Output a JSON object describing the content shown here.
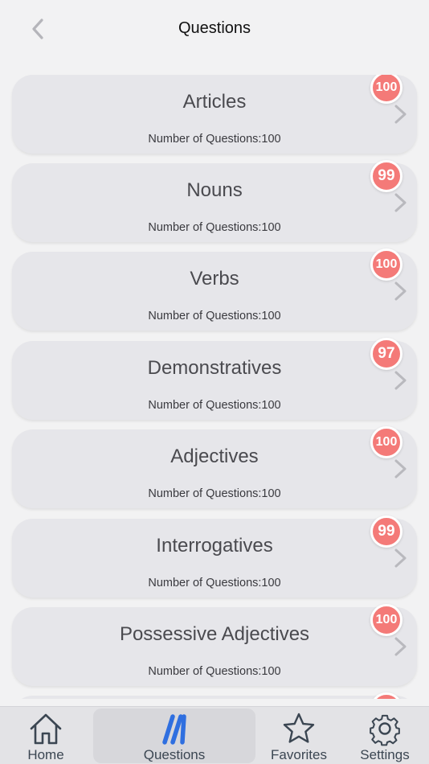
{
  "header": {
    "title": "Questions",
    "back_icon": "chevron-left-icon"
  },
  "categories": [
    {
      "title": "Articles",
      "subtitle": "Number of Questions:100",
      "badge": "100"
    },
    {
      "title": "Nouns",
      "subtitle": "Number of Questions:100",
      "badge": "99"
    },
    {
      "title": "Verbs",
      "subtitle": "Number of Questions:100",
      "badge": "100"
    },
    {
      "title": "Demonstratives",
      "subtitle": "Number of Questions:100",
      "badge": "97"
    },
    {
      "title": "Adjectives",
      "subtitle": "Number of Questions:100",
      "badge": "100"
    },
    {
      "title": "Interrogatives",
      "subtitle": "Number of Questions:100",
      "badge": "99"
    },
    {
      "title": "Possessive Adjectives",
      "subtitle": "Number of Questions:100",
      "badge": "100"
    }
  ],
  "tabbar": {
    "items": [
      {
        "label": "Home",
        "icon": "home-icon"
      },
      {
        "label": "Questions",
        "icon": "questions-icon",
        "active": true
      },
      {
        "label": "Favorites",
        "icon": "star-icon"
      },
      {
        "label": "Settings",
        "icon": "gear-icon"
      }
    ]
  },
  "colors": {
    "background": "#f2f2f3",
    "card": "#e6e6ea",
    "badge": "#f47a78",
    "accent_blue": "#2f6fe0",
    "tab_icon": "#3b4652"
  }
}
